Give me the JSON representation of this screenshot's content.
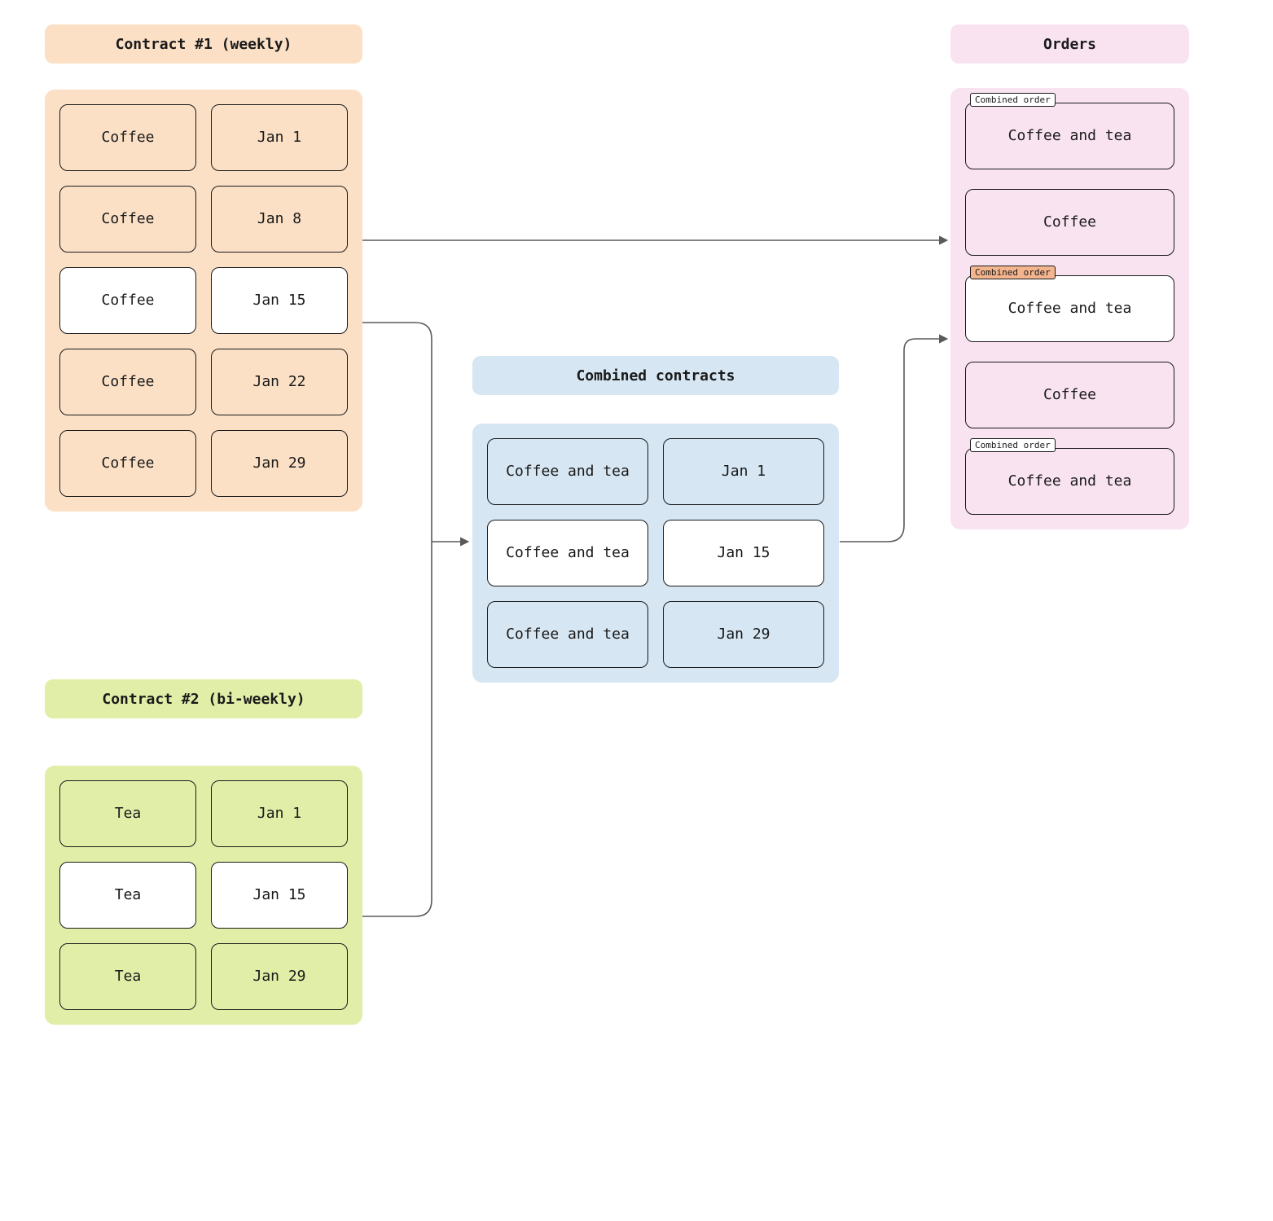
{
  "contract1": {
    "title": "Contract #1 (weekly)",
    "rows": [
      {
        "item": "Coffee",
        "date": "Jan 1",
        "highlight": false
      },
      {
        "item": "Coffee",
        "date": "Jan 8",
        "highlight": false
      },
      {
        "item": "Coffee",
        "date": "Jan 15",
        "highlight": true
      },
      {
        "item": "Coffee",
        "date": "Jan 22",
        "highlight": false
      },
      {
        "item": "Coffee",
        "date": "Jan 29",
        "highlight": false
      }
    ]
  },
  "contract2": {
    "title": "Contract #2 (bi-weekly)",
    "rows": [
      {
        "item": "Tea",
        "date": "Jan 1",
        "highlight": false
      },
      {
        "item": "Tea",
        "date": "Jan 15",
        "highlight": true
      },
      {
        "item": "Tea",
        "date": "Jan 29",
        "highlight": false
      }
    ]
  },
  "combined": {
    "title": "Combined contracts",
    "rows": [
      {
        "item": "Coffee and tea",
        "date": "Jan 1",
        "highlight": false
      },
      {
        "item": "Coffee and tea",
        "date": "Jan 15",
        "highlight": true
      },
      {
        "item": "Coffee and tea",
        "date": "Jan 29",
        "highlight": false
      }
    ]
  },
  "orders": {
    "title": "Orders",
    "badge_label": "Combined order",
    "items": [
      {
        "label": "Coffee and tea",
        "highlight": false,
        "badge": "default"
      },
      {
        "label": "Coffee",
        "highlight": false,
        "badge": null
      },
      {
        "label": "Coffee and tea",
        "highlight": true,
        "badge": "accent"
      },
      {
        "label": "Coffee",
        "highlight": false,
        "badge": null
      },
      {
        "label": "Coffee and tea",
        "highlight": false,
        "badge": "default"
      }
    ]
  }
}
